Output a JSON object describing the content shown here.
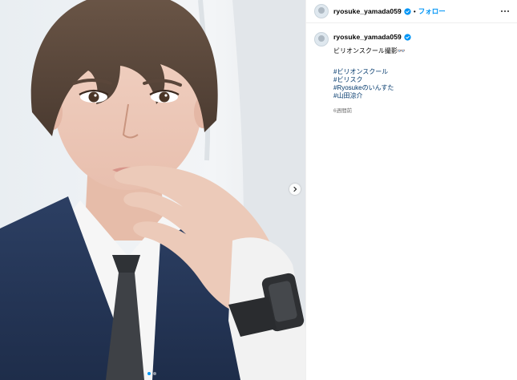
{
  "post": {
    "username": "ryosuke_yamada059",
    "separator": "•",
    "follow_label": "フォロー",
    "caption": "ビリオンスクール撮影👓",
    "hashtags": [
      "#ビリオンスクール",
      "#ビリスク",
      "#Ryosukeのいんすた",
      "#山田涼介"
    ],
    "time_ago": "6週間前"
  },
  "carousel": {
    "current_slide": 1,
    "total_slides": 2
  },
  "icons": {
    "verified": "verified-badge-icon",
    "more": "more-options-icon",
    "next": "chevron-right-icon"
  },
  "colors": {
    "follow": "#0095f6",
    "hashtag": "#00376b",
    "verified": "#0095f6",
    "timestamp": "#737373"
  }
}
